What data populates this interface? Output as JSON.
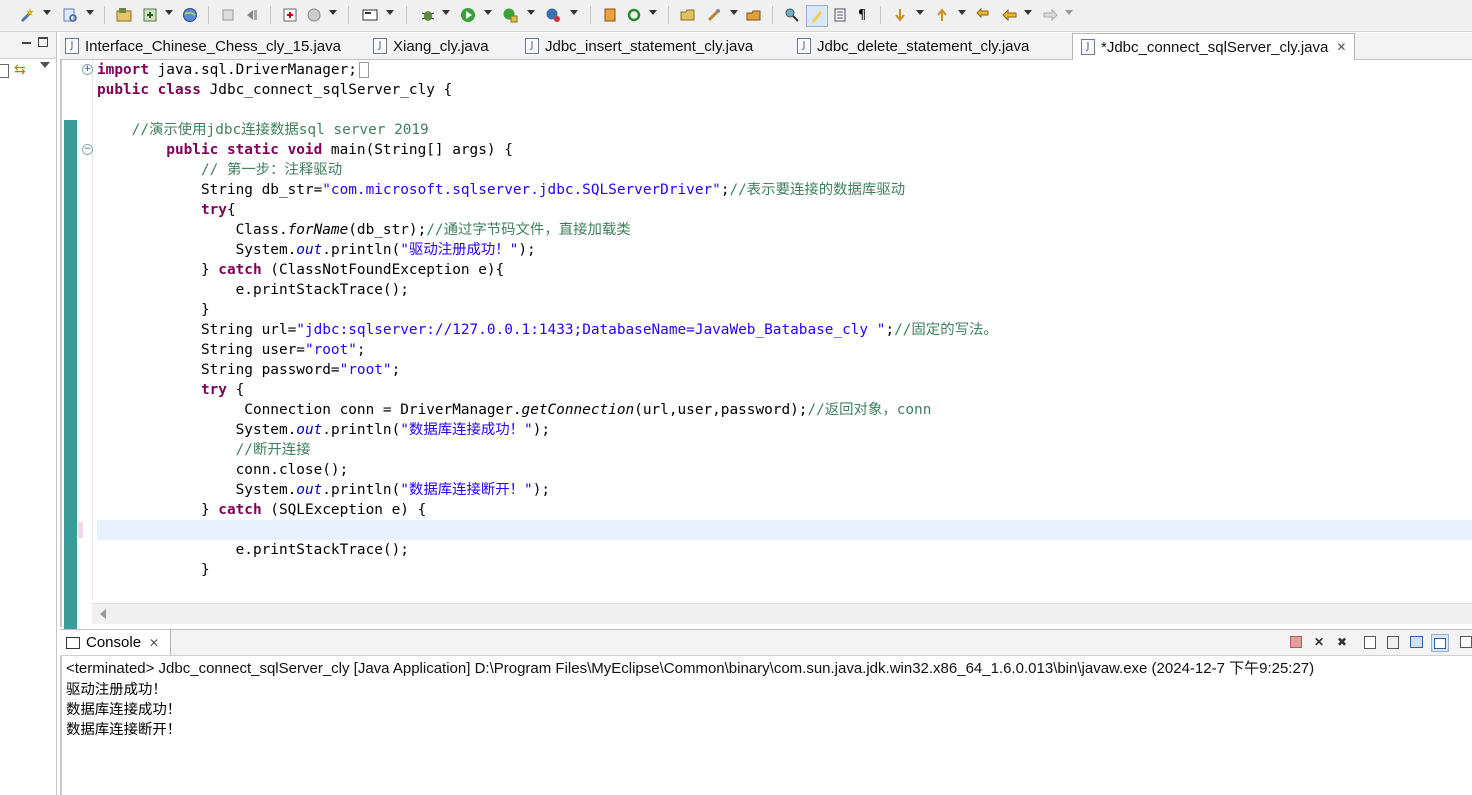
{
  "toolbar": {
    "buttons": [
      "new-wizard",
      "open-type",
      "new-java-project",
      "new-package",
      "new-class",
      "web-browser",
      "deploy",
      "run-last-tool",
      "console",
      "debug",
      "run",
      "run-as",
      "coverage",
      "new-server",
      "refresh",
      "open-type-hierarchy",
      "open-task",
      "search",
      "toggle-mark-occurrences",
      "highlight",
      "show-whitespace",
      "paragraph",
      "next-annotation",
      "previous-annotation",
      "last-edit",
      "back",
      "forward"
    ]
  },
  "tabs": [
    {
      "label": "Interface_Chinese_Chess_cly_15.java"
    },
    {
      "label": "Xiang_cly.java"
    },
    {
      "label": "Jdbc_insert_statement_cly.java"
    },
    {
      "label": "Jdbc_delete_statement_cly.java"
    },
    {
      "label": "*Jdbc_connect_sqlServer_cly.java"
    }
  ],
  "code": {
    "l1a": "import",
    "l1b": " java.sql.DriverManager;",
    "l2a": "public class",
    "l2b": " Jdbc_connect_sqlServer_cly {",
    "l4": "    //演示使用jdbc连接数据sql server 2019",
    "l5a": "        public static void",
    "l5b": " main(String[] args) {",
    "l6": "            // 第一步：注释驱动",
    "l7a": "            String db_str=",
    "l7b": "\"com.microsoft.sqlserver.jdbc.SQLServerDriver\"",
    "l7c": ";",
    "l7d": "//表示要连接的数据库驱动",
    "l8a": "            try",
    "l8b": "{",
    "l9a": "                Class.",
    "l9b": "forName",
    "l9c": "(db_str);",
    "l9d": "//通过字节码文件，直接加载类",
    "l10a": "                System.",
    "l10b": "out",
    "l10c": ".println(",
    "l10d": "\"驱动注册成功！\"",
    "l10e": ");",
    "l11a": "            } ",
    "l11b": "catch",
    "l11c": " (ClassNotFoundException e){",
    "l12": "                e.printStackTrace();",
    "l13": "            }",
    "l14a": "            String url=",
    "l14b": "\"jdbc:sqlserver://127.0.0.1:1433;DatabaseName=JavaWeb_Batabase_cly \"",
    "l14c": ";",
    "l14d": "//固定的写法。",
    "l15a": "            String user=",
    "l15b": "\"root\"",
    "l15c": ";",
    "l16a": "            String password=",
    "l16b": "\"root\"",
    "l16c": ";",
    "l17a": "            try",
    "l17b": " {",
    "l18a": "                 Connection conn = DriverManager.",
    "l18b": "getConnection",
    "l18c": "(url,user,password);",
    "l18d": "//返回对象，conn",
    "l19a": "                System.",
    "l19b": "out",
    "l19c": ".println(",
    "l19d": "\"数据库连接成功！\"",
    "l19e": ");",
    "l20": "                //断开连接",
    "l21": "                conn.close();",
    "l22a": "                System.",
    "l22b": "out",
    "l22c": ".println(",
    "l22d": "\"数据库连接断开！\"",
    "l22e": ");",
    "l23a": "            } ",
    "l23b": "catch",
    "l23c": " (SQLException e) {",
    "l25": "                e.printStackTrace();",
    "l26": "            }"
  },
  "console": {
    "tab_label": "Console",
    "status": "<terminated> Jdbc_connect_sqlServer_cly [Java Application] D:\\Program Files\\MyEclipse\\Common\\binary\\com.sun.java.jdk.win32.x86_64_1.6.0.013\\bin\\javaw.exe (2024-12-7 下午9:25:27)",
    "output": [
      "驱动注册成功！",
      "数据库连接成功！",
      "数据库连接断开！"
    ]
  },
  "colors": {
    "keyword": "#7f0055",
    "comment": "#3f7f5f",
    "string": "#2a00ff",
    "field": "#0000c0",
    "ruler": "#3a9b9b",
    "current_line": "#e8f2fe"
  }
}
